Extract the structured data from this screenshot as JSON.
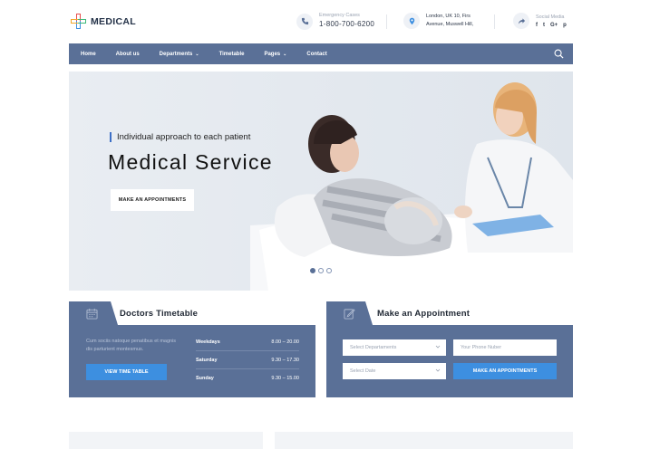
{
  "brand": {
    "name": "MEDICAL"
  },
  "header": {
    "emergency": {
      "label": "Emergency Cases",
      "phone": "1-800-700-6200"
    },
    "address": {
      "line1": "London, UK 10, Firs",
      "line2": "Avenue, Muswell Hill,"
    },
    "social": {
      "label": "Social Media",
      "icons": [
        "f",
        "t",
        "G+",
        "p"
      ]
    }
  },
  "nav": {
    "items": [
      {
        "label": "Home",
        "dropdown": false
      },
      {
        "label": "About us",
        "dropdown": false
      },
      {
        "label": "Departments",
        "dropdown": true
      },
      {
        "label": "Timetable",
        "dropdown": false
      },
      {
        "label": "Pages",
        "dropdown": true
      },
      {
        "label": "Contact",
        "dropdown": false
      }
    ],
    "search_icon": "search-icon"
  },
  "hero": {
    "subtitle": "Individual approach to each patient",
    "title": "Medical Service",
    "button": "MAKE AN APPOINTMENTS",
    "slides": 3,
    "active_slide": 0
  },
  "timetable": {
    "title": "Doctors Timetable",
    "text": "Cum sociis natoque penatibus et magnis dis parturient montesmus.",
    "button": "VIEW TIME TABLE",
    "rows": [
      {
        "day": "Weekdays",
        "hours": "8.00 – 20.00"
      },
      {
        "day": "Saturday",
        "hours": "9.30 – 17.30"
      },
      {
        "day": "Sunday",
        "hours": "9.30 – 15.00"
      }
    ]
  },
  "appointment": {
    "title": "Make an Appointment",
    "department_placeholder": "Select Departaments",
    "phone_placeholder": "Your Phone Nuber",
    "date_placeholder": "Select Date",
    "button": "MAKE AN APPOINTMENTS"
  },
  "colors": {
    "primary": "#5a7097",
    "accent": "#3d8fe0"
  }
}
